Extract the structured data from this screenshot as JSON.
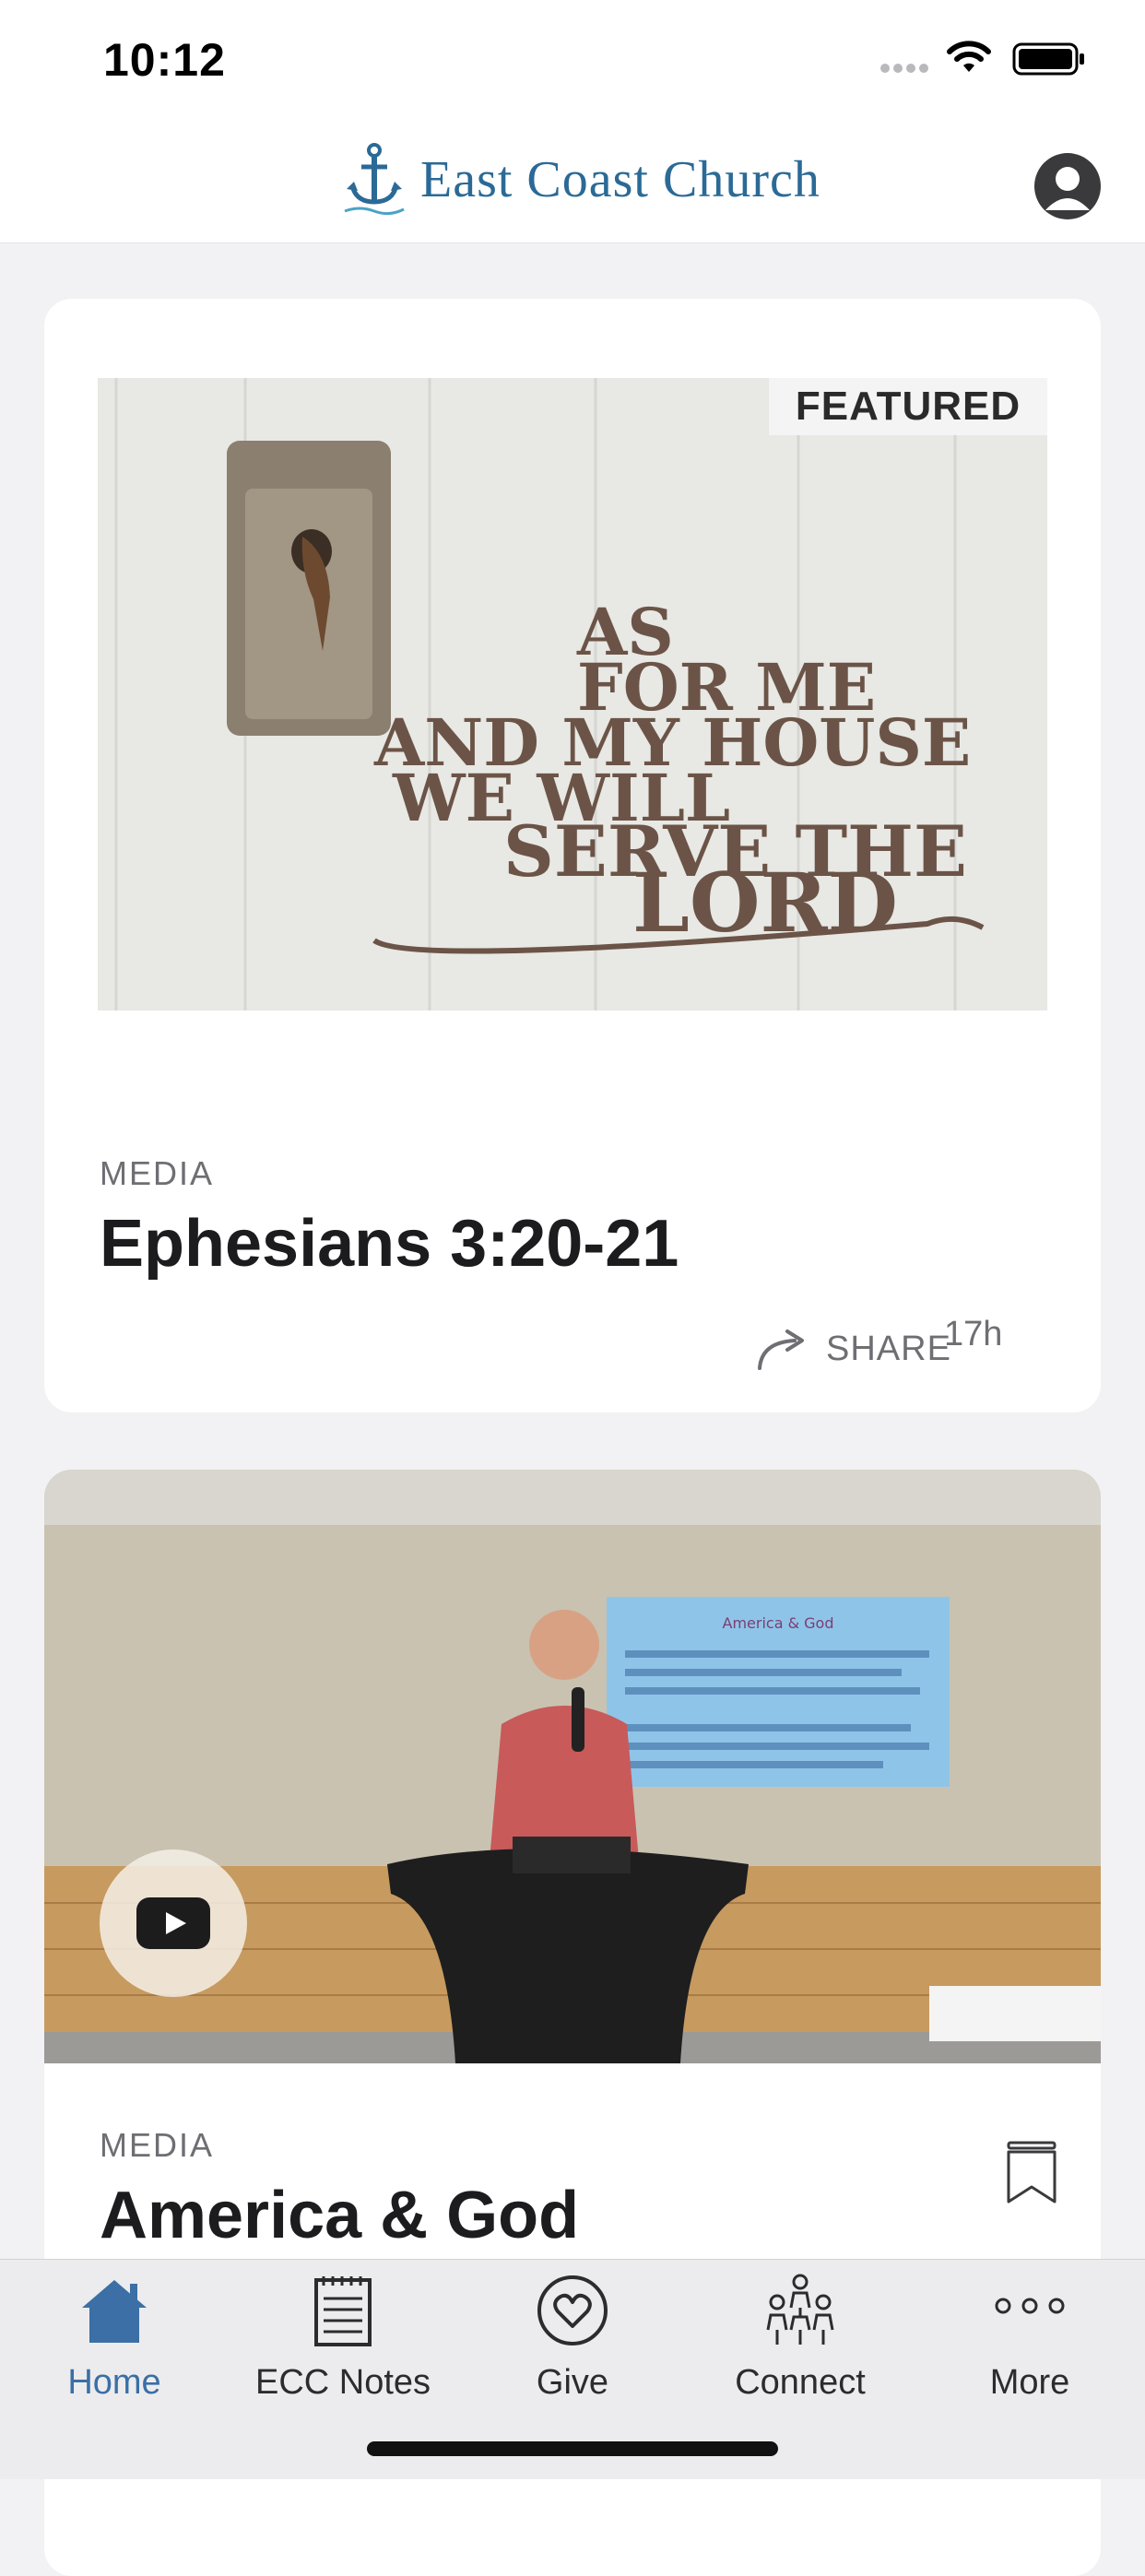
{
  "status_bar": {
    "time": "10:12"
  },
  "header": {
    "brand_name": "East Coast Church"
  },
  "featured_card": {
    "badge": "FEATURED",
    "category": "MEDIA",
    "title": "Ephesians 3:20-21",
    "share_label": "SHARE",
    "time_ago": "17h",
    "image_sign_text": [
      "AS",
      "FOR ME",
      "AND MY HOUSE",
      "WE WILL",
      "SERVE THE",
      "LORD"
    ]
  },
  "media_card": {
    "category": "MEDIA",
    "title": "America & God",
    "slide_title": "America & God"
  },
  "tab_bar": {
    "tabs": [
      {
        "label": "Home",
        "icon": "house-icon",
        "active": true
      },
      {
        "label": "ECC Notes",
        "icon": "notepad-icon",
        "active": false
      },
      {
        "label": "Give",
        "icon": "heart-icon",
        "active": false
      },
      {
        "label": "Connect",
        "icon": "people-icon",
        "active": false
      },
      {
        "label": "More",
        "icon": "more-dots-icon",
        "active": false
      }
    ]
  },
  "colors": {
    "brand": "#2b6a96",
    "active_tab": "#3b6fa5",
    "background": "#f2f2f4"
  }
}
